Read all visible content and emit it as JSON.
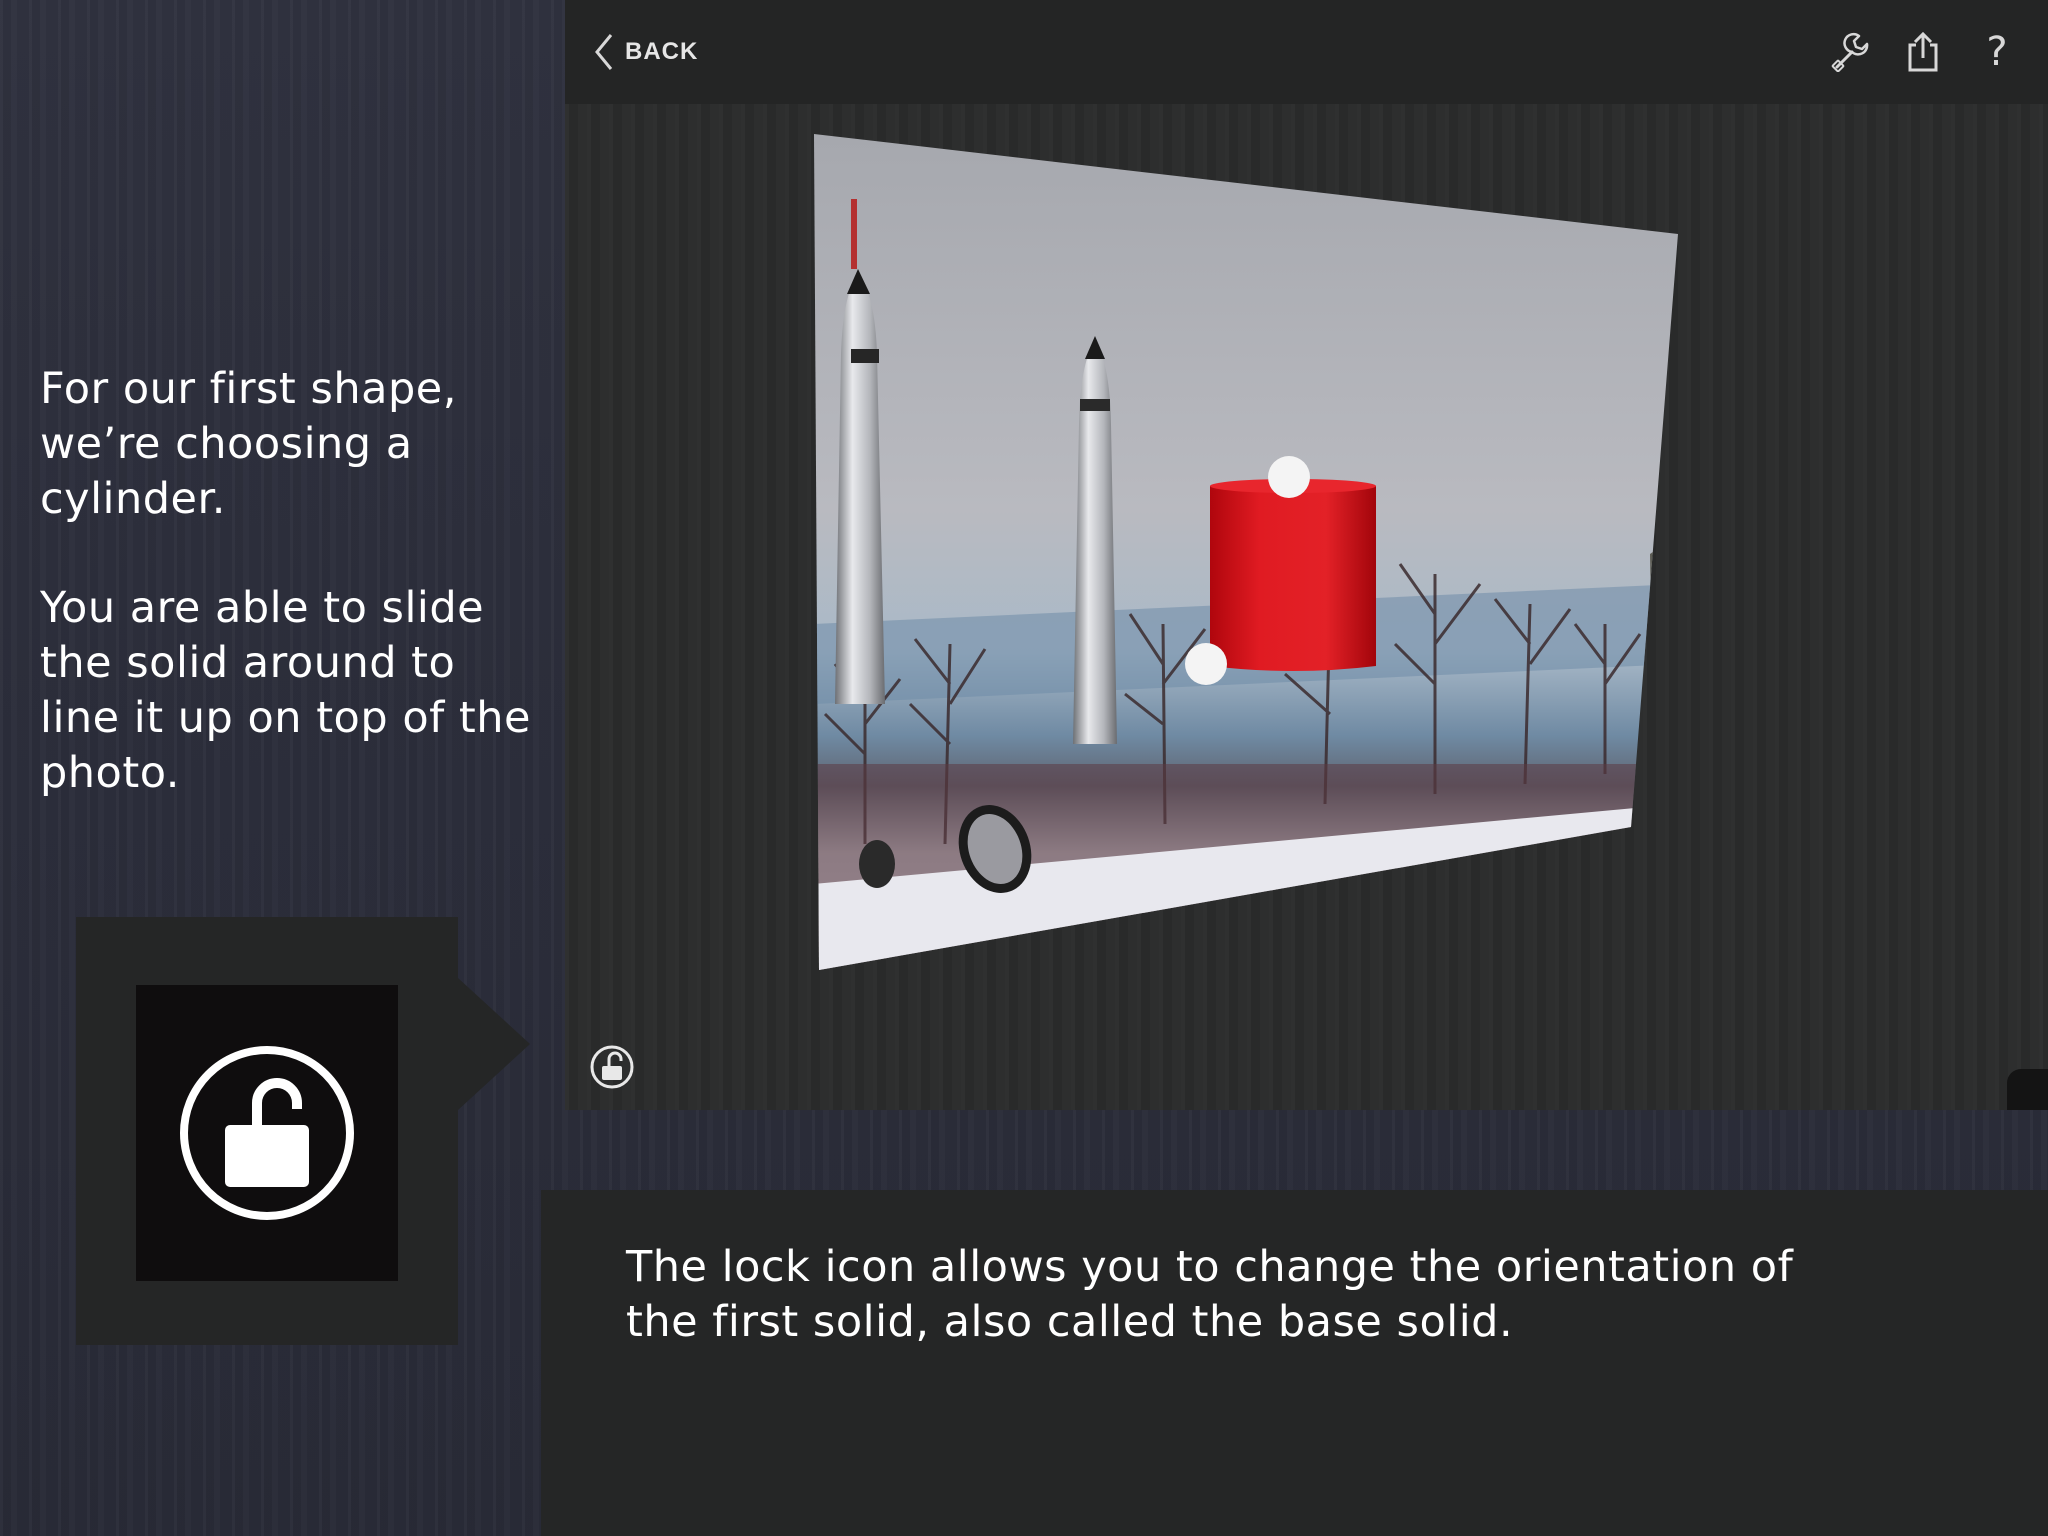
{
  "intro": {
    "paragraph1": "For our first shape, we’re choosing a cylinder.",
    "paragraph2": "You are able to slide the solid around to line it up on top of the photo."
  },
  "callout": {
    "icon": "lock-open-icon"
  },
  "app": {
    "toolbar": {
      "back_label": "BACK",
      "back_icon": "chevron-left-icon",
      "tools_icon": "wrench-icon",
      "share_icon": "share-icon",
      "help_label": "?"
    },
    "canvas": {
      "photo_subject": "rockets in a snowy park",
      "solid": "cylinder",
      "solid_color": "#e01b22",
      "lock_icon": "lock-open-icon",
      "side_menu_icon": "more-vertical-icon"
    }
  },
  "caption": {
    "text": "The lock icon allows you to change the orientation of the first solid, also called the base solid."
  }
}
